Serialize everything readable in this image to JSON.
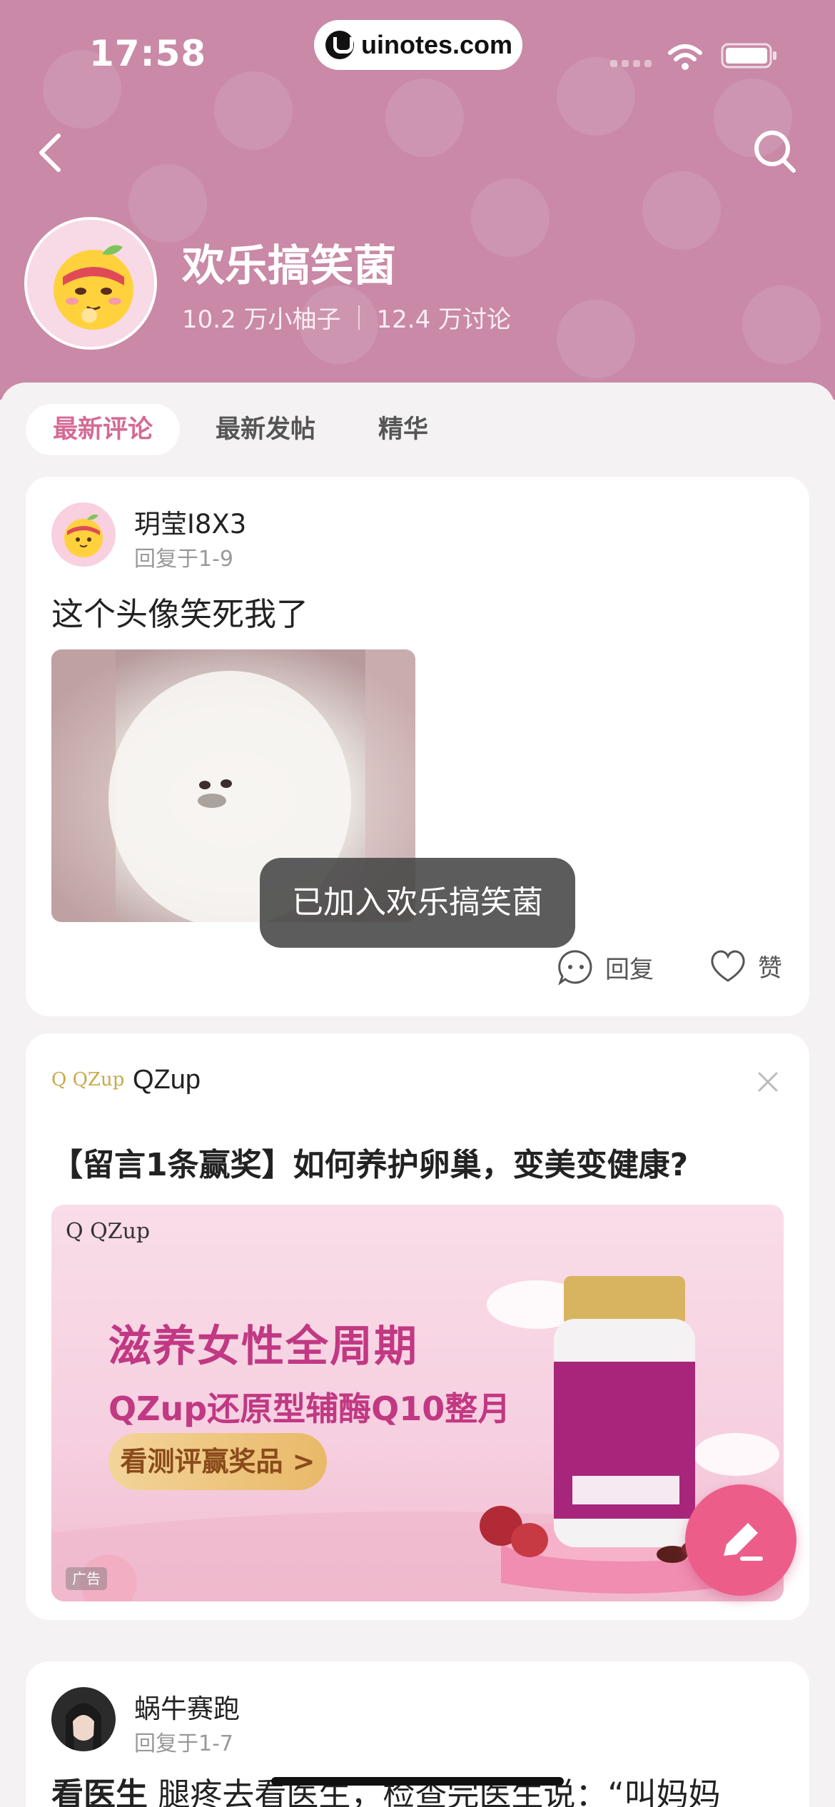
{
  "status_bar": {
    "time": "17:58",
    "url": "uinotes.com"
  },
  "group": {
    "title": "欢乐搞笑菌",
    "members": "10.2 万小柚子",
    "discussions": "12.4 万讨论"
  },
  "tabs": [
    {
      "label": "最新评论",
      "active": true
    },
    {
      "label": "最新发帖",
      "active": false
    },
    {
      "label": "精华",
      "active": false
    }
  ],
  "post1": {
    "user": "玥莹I8X3",
    "sub": "回复于1-9",
    "text": "这个头像笑死我了",
    "reply_label": "回复",
    "like_label": "赞"
  },
  "toast": "已加入欢乐搞笑菌",
  "ad": {
    "logo_small": "Q QZup",
    "brand": "QZup",
    "headline": "【留言1条赢奖】如何养护卵巢，变美变健康?",
    "banner_logo": "Q QZup",
    "line1": "滋养女性全周期",
    "line2": "QZup还原型辅酶Q10整月",
    "cta": "看测评赢奖品 >",
    "badge": "广告"
  },
  "post2": {
    "user": "蜗牛赛跑",
    "sub": "回复于1-7",
    "text_bold": "看医生",
    "text": " 腿疼去看医生，检查完医生说：“叫妈妈"
  },
  "colors": {
    "accent": "#d46a95",
    "header": "#c989a7",
    "fab": "#ec5d8a"
  }
}
